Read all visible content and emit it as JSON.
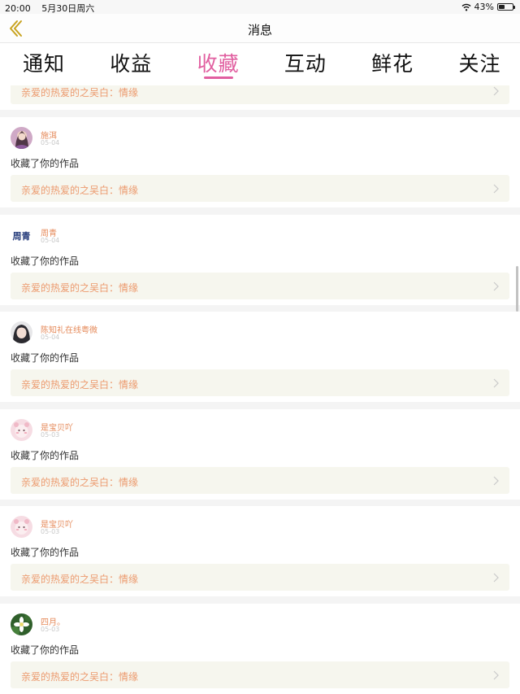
{
  "status_bar": {
    "time": "20:00",
    "date": "5月30日周六",
    "battery_pct": "43%",
    "battery_level": 0.43
  },
  "nav": {
    "title": "消息",
    "back_icon": "chevron-left-icon"
  },
  "tabs": [
    {
      "label": "通知",
      "active": false
    },
    {
      "label": "收益",
      "active": false
    },
    {
      "label": "收藏",
      "active": true
    },
    {
      "label": "互动",
      "active": false
    },
    {
      "label": "鲜花",
      "active": false
    },
    {
      "label": "关注",
      "active": false
    }
  ],
  "accent_color": "#e15fa0",
  "partial_card": {
    "work_text": "亲爱的热爱的之吴白：情缘"
  },
  "items": [
    {
      "name": "施洱",
      "date": "05-04",
      "action": "收藏了你的作品",
      "work": "亲爱的热爱的之吴白：情缘",
      "avatar": "girl-portrait"
    },
    {
      "name": "周青",
      "date": "05-04",
      "action": "收藏了你的作品",
      "work": "亲爱的热爱的之吴白：情缘",
      "avatar": "text-logo",
      "avatar_text": "周青"
    },
    {
      "name": "陈知礼在线粤微",
      "date": "05-04",
      "action": "收藏了你的作品",
      "work": "亲爱的热爱的之吴白：情缘",
      "avatar": "anime-face"
    },
    {
      "name": "是宝贝吖",
      "date": "05-03",
      "action": "收藏了你的作品",
      "work": "亲爱的热爱的之吴白：情缘",
      "avatar": "pink-cartoon"
    },
    {
      "name": "是宝贝吖",
      "date": "05-03",
      "action": "收藏了你的作品",
      "work": "亲爱的热爱的之吴白：情缘",
      "avatar": "pink-cartoon"
    },
    {
      "name": "四月。",
      "date": "05-03",
      "action": "收藏了你的作品",
      "work": "亲爱的热爱的之吴白：情缘",
      "avatar": "flower-photo"
    }
  ]
}
